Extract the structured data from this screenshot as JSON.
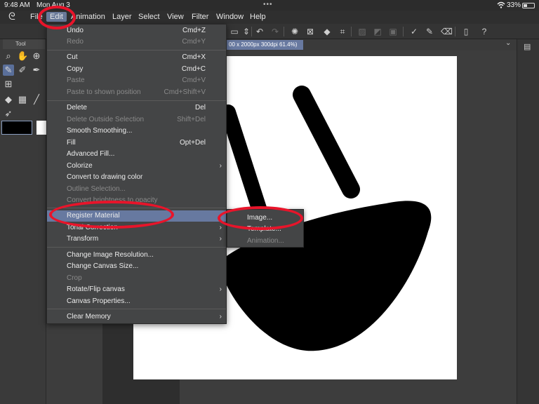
{
  "status_bar": {
    "time": "9:48 AM",
    "date": "Mon Aug 3",
    "dots": "•••",
    "battery": "33%"
  },
  "menu_bar": {
    "items": [
      "File",
      "Edit",
      "Animation",
      "Layer",
      "Select",
      "View",
      "Filter",
      "Window",
      "Help"
    ],
    "active": "Edit"
  },
  "tool_panel": {
    "tab_label": "Tool"
  },
  "canvas": {
    "tab_title": "00 x 2000px 300dpi 61.4%)",
    "background": "#ffffff"
  },
  "edit_menu": {
    "items": [
      {
        "label": "Undo",
        "shortcut": "Cmd+Z"
      },
      {
        "label": "Redo",
        "shortcut": "Cmd+Y",
        "disabled": true
      },
      {
        "label": "Cut",
        "shortcut": "Cmd+X"
      },
      {
        "label": "Copy",
        "shortcut": "Cmd+C"
      },
      {
        "label": "Paste",
        "shortcut": "Cmd+V",
        "disabled": true
      },
      {
        "label": "Paste to shown position",
        "shortcut": "Cmd+Shift+V",
        "disabled": true
      },
      {
        "label": "Delete",
        "shortcut": "Del"
      },
      {
        "label": "Delete Outside Selection",
        "shortcut": "Shift+Del",
        "disabled": true
      },
      {
        "label": "Smooth Smoothing..."
      },
      {
        "label": "Fill",
        "shortcut": "Opt+Del"
      },
      {
        "label": "Advanced Fill..."
      },
      {
        "label": "Colorize",
        "submenu": true
      },
      {
        "label": "Convert to drawing color"
      },
      {
        "label": "Outline Selection...",
        "disabled": true
      },
      {
        "label": "Convert brightness to opacity",
        "disabled": true
      },
      {
        "label": "Register Material",
        "submenu": true,
        "highlighted": true
      },
      {
        "label": "Tonal Correction",
        "submenu": true
      },
      {
        "label": "Transform",
        "submenu": true
      },
      {
        "label": "Change Image Resolution..."
      },
      {
        "label": "Change Canvas Size..."
      },
      {
        "label": "Crop",
        "disabled": true
      },
      {
        "label": "Rotate/Flip canvas",
        "submenu": true
      },
      {
        "label": "Canvas Properties..."
      },
      {
        "label": "Clear Memory",
        "submenu": true
      }
    ]
  },
  "register_material_submenu": {
    "items": [
      {
        "label": "Image..."
      },
      {
        "label": "Template..."
      },
      {
        "label": "Animation...",
        "disabled": true
      }
    ]
  },
  "colors": {
    "accent": "#6779a0",
    "annotation_red": "#e8142a",
    "menu_bg": "#444546"
  }
}
